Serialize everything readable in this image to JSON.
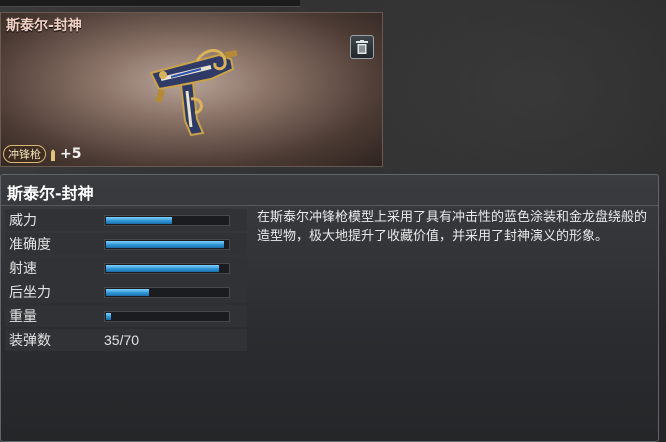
{
  "item": {
    "name": "斯泰尔-封神",
    "type_badge": "冲锋枪",
    "ammo_bonus": "+5",
    "icons": {
      "delete": "trash-icon",
      "ammo": "bullet-icon",
      "weapon": "weapon-image"
    }
  },
  "detail": {
    "title": "斯泰尔-封神",
    "stats": [
      {
        "label": "威力",
        "level": 0.55
      },
      {
        "label": "准确度",
        "level": 0.97
      },
      {
        "label": "射速",
        "level": 0.93
      },
      {
        "label": "后坐力",
        "level": 0.36
      },
      {
        "label": "重量",
        "level": 0.06
      }
    ],
    "magazine": {
      "label": "装弹数",
      "value": "35/70"
    },
    "description": "在斯泰尔冲锋枪模型上采用了具有冲击性的蓝色涂装和金龙盘绕般的造型物，极大地提升了收藏价值，并采用了封神演义的形象。"
  },
  "colors": {
    "bar": "#2b8fd0",
    "panel": "#2a2c2f",
    "card": "#8c7468"
  }
}
